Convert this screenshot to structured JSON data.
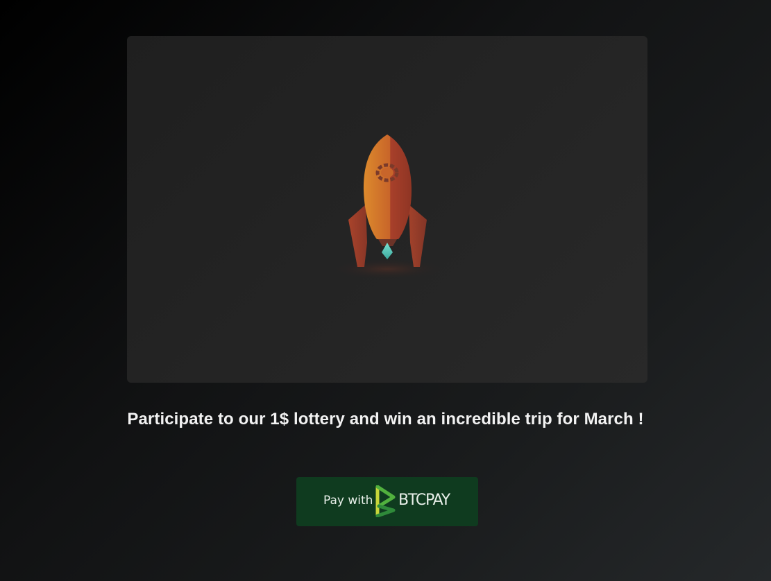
{
  "hero": {
    "image": "rocket-illustration"
  },
  "headline": "Participate to our 1$ lottery and win an incredible trip for March !",
  "payment": {
    "prefix_label": "Pay with",
    "brand_label": "BTCPAY",
    "logo_icon": "btcpay-logo-icon",
    "background_color": "#0f3b1f"
  },
  "colors": {
    "rocket_body": "#d46a2a",
    "rocket_shade": "#a53d22",
    "flame": "#5fd3c4"
  }
}
